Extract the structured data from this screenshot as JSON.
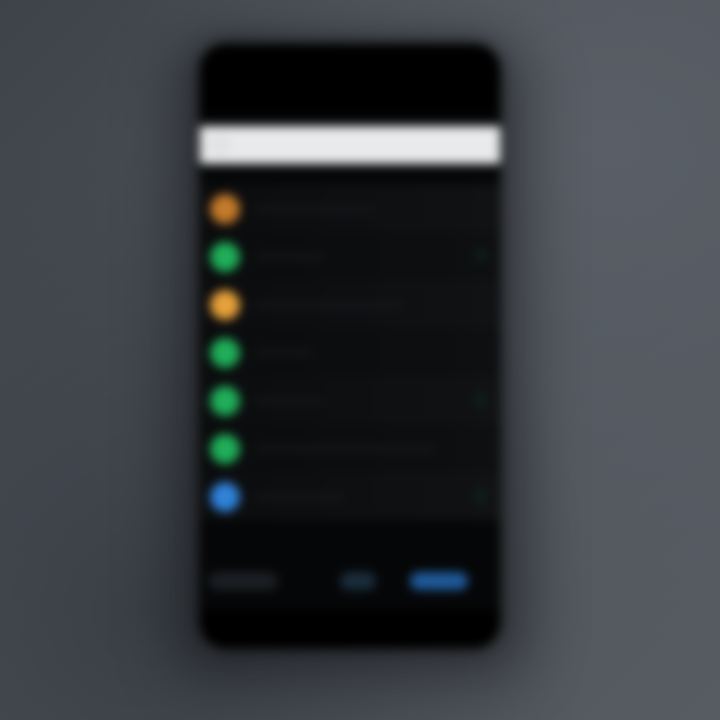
{
  "app": {
    "title": "",
    "search": {
      "placeholder": "",
      "value": ""
    }
  },
  "colors": {
    "orange": "#e7a13a",
    "green": "#1fae59",
    "blue": "#2f82d8",
    "search_bg": "#e9eaec",
    "phone_bg": "#050607"
  },
  "list_items": [
    {
      "label": "",
      "icon": "orange-circle-icon",
      "color": "#c47a2a"
    },
    {
      "label": "",
      "icon": "green-circle-icon",
      "color": "#1fae59"
    },
    {
      "label": "",
      "icon": "orange-circle-icon",
      "color": "#e7a13a"
    },
    {
      "label": "",
      "icon": "green-circle-icon",
      "color": "#1fae59"
    },
    {
      "label": "",
      "icon": "green-circle-icon",
      "color": "#1fae59"
    },
    {
      "label": "",
      "icon": "green-circle-icon",
      "color": "#1fae59"
    },
    {
      "label": "",
      "icon": "blue-circle-icon",
      "color": "#2f82d8"
    }
  ],
  "bottom_actions": {
    "left_label": "",
    "right_label": ""
  }
}
